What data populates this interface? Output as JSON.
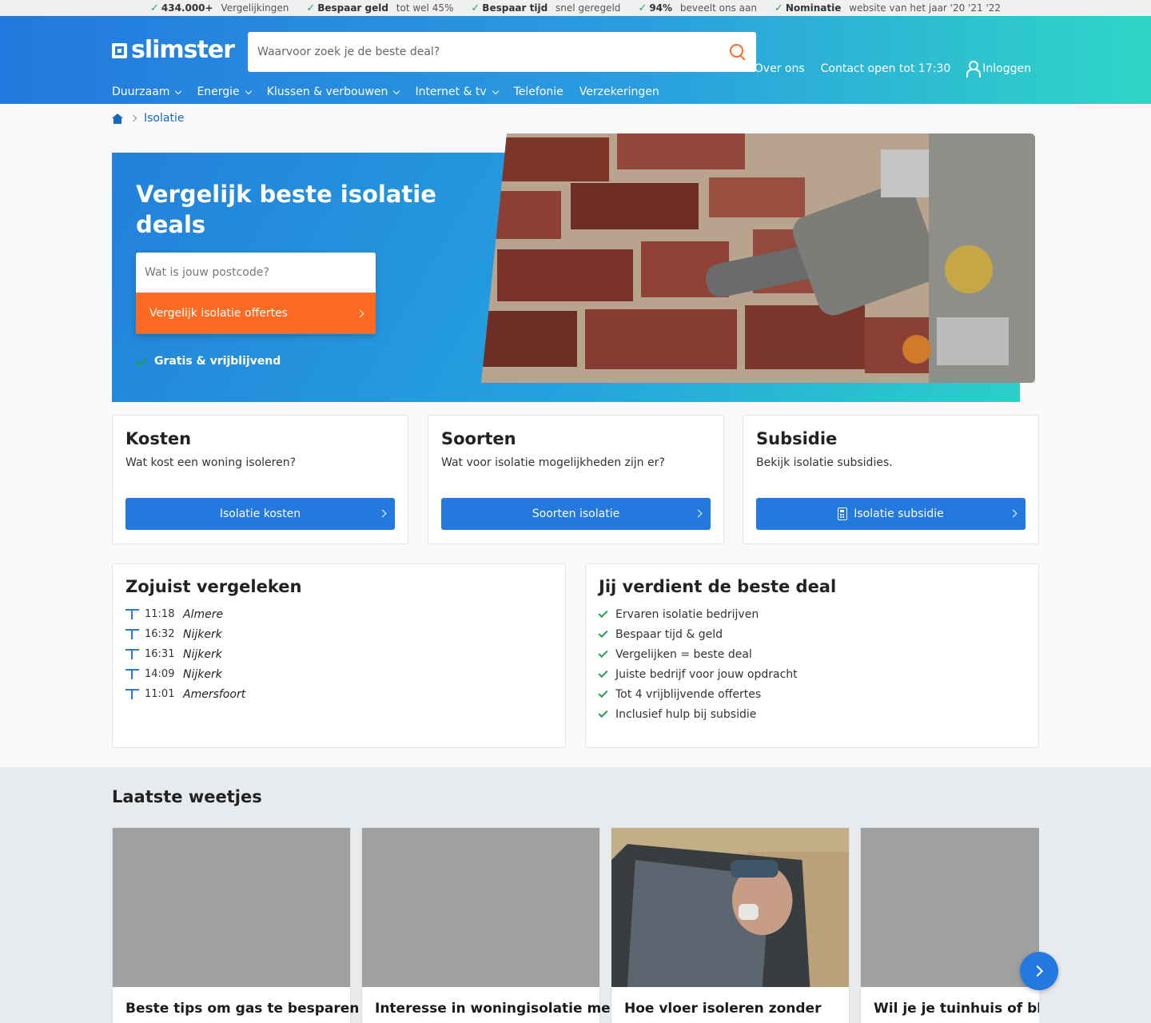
{
  "usps": [
    {
      "bold": "434.000+",
      "text": "Vergelijkingen"
    },
    {
      "bold": "Bespaar geld",
      "text": "tot wel 45%"
    },
    {
      "bold": "Bespaar tijd",
      "text": "snel geregeld"
    },
    {
      "bold": "94%",
      "text": "beveelt ons aan"
    },
    {
      "bold": "Nominatie",
      "text": "website van het jaar '20 '21 '22"
    }
  ],
  "header": {
    "logo": "slimster",
    "search_placeholder": "Waarvoor zoek je de beste deal?",
    "links": {
      "about": "Over ons",
      "contact": "Contact open tot 17:30",
      "login": "Inloggen"
    },
    "nav": [
      "Duurzaam",
      "Energie",
      "Klussen & verbouwen",
      "Internet & tv",
      "Telefonie",
      "Verzekeringen"
    ]
  },
  "breadcrumb": {
    "current": "Isolatie"
  },
  "hero": {
    "title": "Vergelijk beste isolatie deals",
    "postcode_placeholder": "Wat is jouw postcode?",
    "cta": "Vergelijk isolatie offertes",
    "free": "Gratis & vrijblijvend"
  },
  "cards": [
    {
      "title": "Kosten",
      "text": "Wat kost een woning isoleren?",
      "button": "Isolatie kosten"
    },
    {
      "title": "Soorten",
      "text": "Wat voor isolatie mogelijkheden zijn er?",
      "button": "Soorten isolatie"
    },
    {
      "title": "Subsidie",
      "text": "Bekijk isolatie subsidies.",
      "button": "Isolatie subsidie"
    }
  ],
  "recent": {
    "title": "Zojuist vergeleken",
    "items": [
      {
        "time": "11:18",
        "city": "Almere"
      },
      {
        "time": "16:32",
        "city": "Nijkerk"
      },
      {
        "time": "16:31",
        "city": "Nijkerk"
      },
      {
        "time": "14:09",
        "city": "Nijkerk"
      },
      {
        "time": "11:01",
        "city": "Amersfoort"
      }
    ]
  },
  "deal": {
    "title": "Jij verdient de beste deal",
    "items": [
      "Ervaren isolatie bedrijven",
      "Bespaar tijd & geld",
      "Vergelijken = beste deal",
      "Juiste bedrijf voor jouw opdracht",
      "Tot 4 vrijblijvende offertes",
      "Inclusief hulp bij subsidie"
    ]
  },
  "tips": {
    "title": "Laatste weetjes",
    "items": [
      {
        "title": "Beste tips om gas te besparen"
      },
      {
        "title": "Interesse in woningisolatie met"
      },
      {
        "title": "Hoe vloer isoleren zonder"
      },
      {
        "title": "Wil je je tuinhuis of blokh"
      }
    ]
  }
}
